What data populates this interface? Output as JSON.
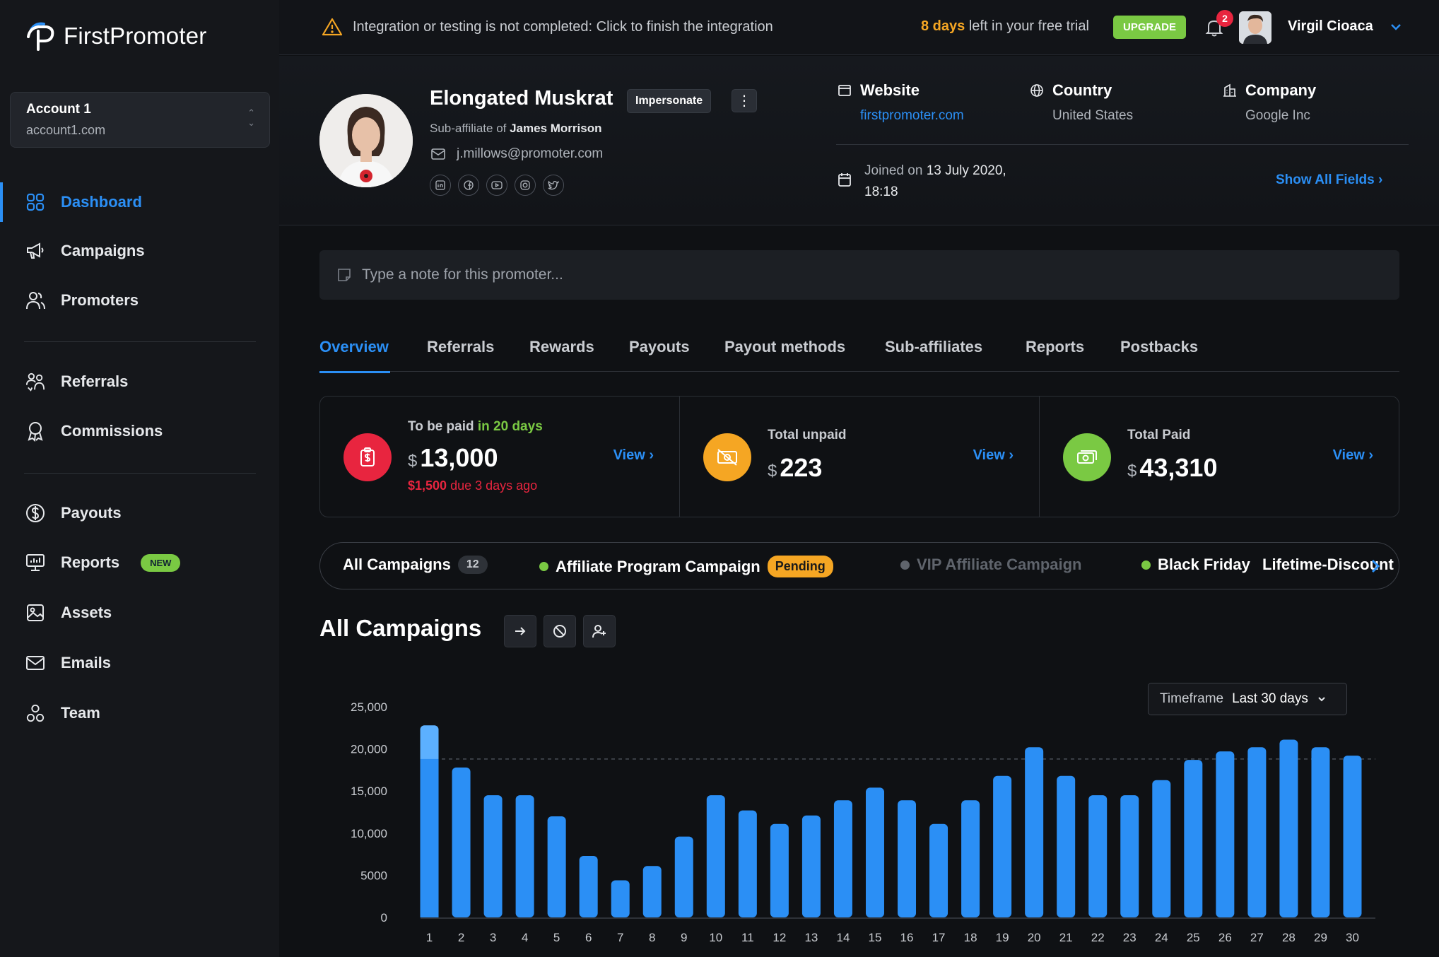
{
  "brand": {
    "name": "FirstPromoter",
    "accent": "#2b8ff5"
  },
  "account": {
    "name": "Account 1",
    "domain": "account1.com"
  },
  "nav": {
    "primary": [
      {
        "label": "Dashboard",
        "icon": "grid-icon",
        "active": true
      },
      {
        "label": "Campaigns",
        "icon": "megaphone-icon"
      },
      {
        "label": "Promoters",
        "icon": "users-icon"
      }
    ],
    "secondary": [
      {
        "label": "Referrals",
        "icon": "referrals-icon"
      },
      {
        "label": "Commissions",
        "icon": "award-icon"
      }
    ],
    "tertiary": [
      {
        "label": "Payouts",
        "icon": "dollar-circle-icon"
      },
      {
        "label": "Reports",
        "icon": "monitor-icon",
        "badge": "NEW"
      },
      {
        "label": "Assets",
        "icon": "image-icon"
      },
      {
        "label": "Emails",
        "icon": "mail-icon"
      },
      {
        "label": "Team",
        "icon": "team-icon"
      }
    ]
  },
  "topbar": {
    "alert": "Integration or testing is not completed: Click to finish the integration",
    "trial_days": "8 days",
    "trial_rest": " left in your free trial",
    "upgrade": "UPGRADE",
    "notifications": "2",
    "user": "Virgil Cioaca"
  },
  "promoter": {
    "name": "Elongated Muskrat",
    "impersonate": "Impersonate",
    "sub_prefix": "Sub-affiliate of ",
    "parent": "James Morrison",
    "email": "j.millows@promoter.com",
    "website_label": "Website",
    "website": "firstpromoter.com",
    "country_label": "Country",
    "country": "United States",
    "company_label": "Company",
    "company": "Google Inc",
    "joined_prefix": "Joined on ",
    "joined_date": "13 July 2020,",
    "joined_time": "18:18",
    "show_all": "Show All Fields"
  },
  "note": {
    "placeholder": "Type a note for this promoter..."
  },
  "tabs": [
    "Overview",
    "Referrals",
    "Rewards",
    "Payouts",
    "Payout methods",
    "Sub-affiliates",
    "Reports",
    "Postbacks"
  ],
  "stats": [
    {
      "title": "To be paid",
      "title_hl": " in 20 days",
      "currency": "$",
      "amount": "13,000",
      "due_amount": "$1,500",
      "due_rest": " due 3 days ago",
      "view": "View ›",
      "color": "#e8253f",
      "icon": "clipboard-dollar-icon"
    },
    {
      "title": "Total unpaid",
      "currency": "$",
      "amount": "223",
      "view": "View ›",
      "color": "#f5a623",
      "icon": "money-off-icon"
    },
    {
      "title": "Total Paid",
      "currency": "$",
      "amount": "43,310",
      "view": "View ›",
      "color": "#7ac943",
      "icon": "money-icon"
    }
  ],
  "campaigns": {
    "all_label": "All Campaigns",
    "all_count": "12",
    "items": [
      {
        "label": "Affiliate Program Campaign",
        "status": "Pending",
        "dot": "#7ac943"
      },
      {
        "label": "VIP Affiliate Campaign",
        "dot": "#5f646c",
        "dim": true
      },
      {
        "label": "Black Friday",
        "dot": "#7ac943"
      },
      {
        "label": "Lifetime-Discount"
      }
    ]
  },
  "section": {
    "title": "All Campaigns"
  },
  "timeframe": {
    "label": "Timeframe",
    "value": "Last 30 days"
  },
  "chart_data": {
    "type": "bar",
    "categories": [
      "1",
      "2",
      "3",
      "4",
      "5",
      "6",
      "7",
      "8",
      "9",
      "10",
      "11",
      "12",
      "13",
      "14",
      "15",
      "16",
      "17",
      "18",
      "19",
      "20",
      "21",
      "22",
      "23",
      "24",
      "25",
      "26",
      "27",
      "28",
      "29",
      "30"
    ],
    "values": [
      22800,
      17800,
      14500,
      14500,
      12000,
      7300,
      4400,
      6100,
      9600,
      14500,
      12700,
      11100,
      12100,
      13900,
      15400,
      13900,
      11100,
      13900,
      16800,
      20200,
      16800,
      14500,
      14500,
      16300,
      18700,
      19700,
      20200,
      21100,
      20200,
      19200
    ],
    "ylim": [
      0,
      25000
    ],
    "yticks": [
      "0",
      "5000",
      "10,000",
      "15,000",
      "20,000",
      "25,000"
    ],
    "reference_line": 18800,
    "color": "#2b8ff5",
    "highlight_color": "#5cb0ff"
  }
}
